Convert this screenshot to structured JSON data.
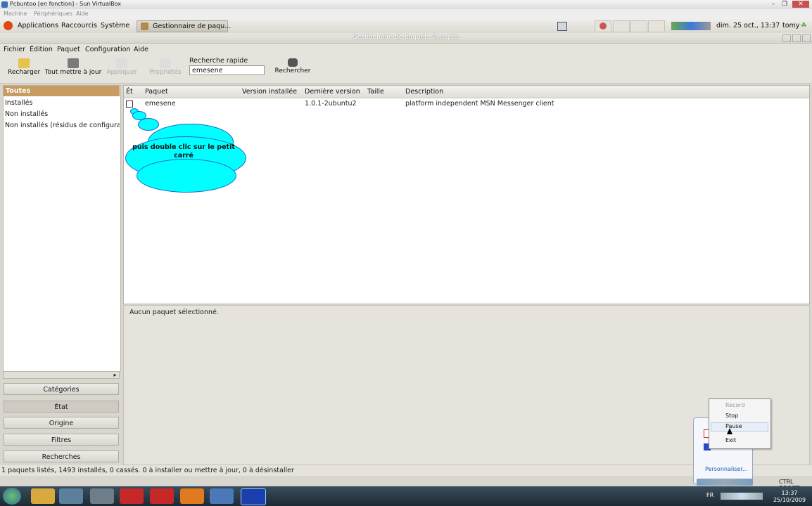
{
  "vbox": {
    "title": "Pcbuntoo [en fonction] - Sun VirtualBox",
    "menu": [
      "Machine",
      "Périphériques",
      "Aide"
    ]
  },
  "gnome_panel": {
    "menus": [
      "Applications",
      "Raccourcis",
      "Système"
    ],
    "task": "Gestionnaire de paqu...",
    "clock": "dim. 25 oct., 13:37",
    "user": "tomy"
  },
  "synaptic": {
    "title": "Gestionnaire de paquets Synaptic",
    "menu": [
      "Fichier",
      "Édition",
      "Paquet",
      "Configuration",
      "Aide"
    ],
    "toolbar": {
      "reload": "Recharger",
      "mark_all": "Tout mettre à jour",
      "apply": "Appliquer",
      "properties": "Propriétés",
      "search": "Rechercher"
    },
    "quick_search": {
      "label": "Recherche rapide",
      "value": "emesene"
    },
    "filters": [
      "Toutes",
      "Installés",
      "Non installés",
      "Non installés (résidus de configuration)"
    ],
    "filter_buttons": [
      "Catégories",
      "État",
      "Origine",
      "Filtres",
      "Recherches"
    ],
    "columns": [
      "Ét",
      "Paquet",
      "Version installée",
      "Dernière version",
      "Taille",
      "Description"
    ],
    "rows": [
      {
        "package": "emesene",
        "installed": "",
        "latest": "1.0.1-2ubuntu2",
        "size": "",
        "description": "platform independent MSN Messenger client"
      }
    ],
    "detail": "Aucun paquet sélectionné.",
    "status": "1 paquets listés, 1493 installés, 0 cassés. 0 à installer ou mettre à jour, 0 à désinstaller"
  },
  "callout": "puis double clic sur le petit carré",
  "tray_menu": [
    "Record",
    "Stop",
    "Pause",
    "Exit"
  ],
  "tray_popup_link": "Personnaliser...",
  "windows_tray": {
    "lang": "FR",
    "host_key": "CTRL DROITE",
    "time": "13:37",
    "date": "25/10/2009"
  },
  "colors": {
    "selection": "#c79b61",
    "callout": "#00ffff"
  }
}
